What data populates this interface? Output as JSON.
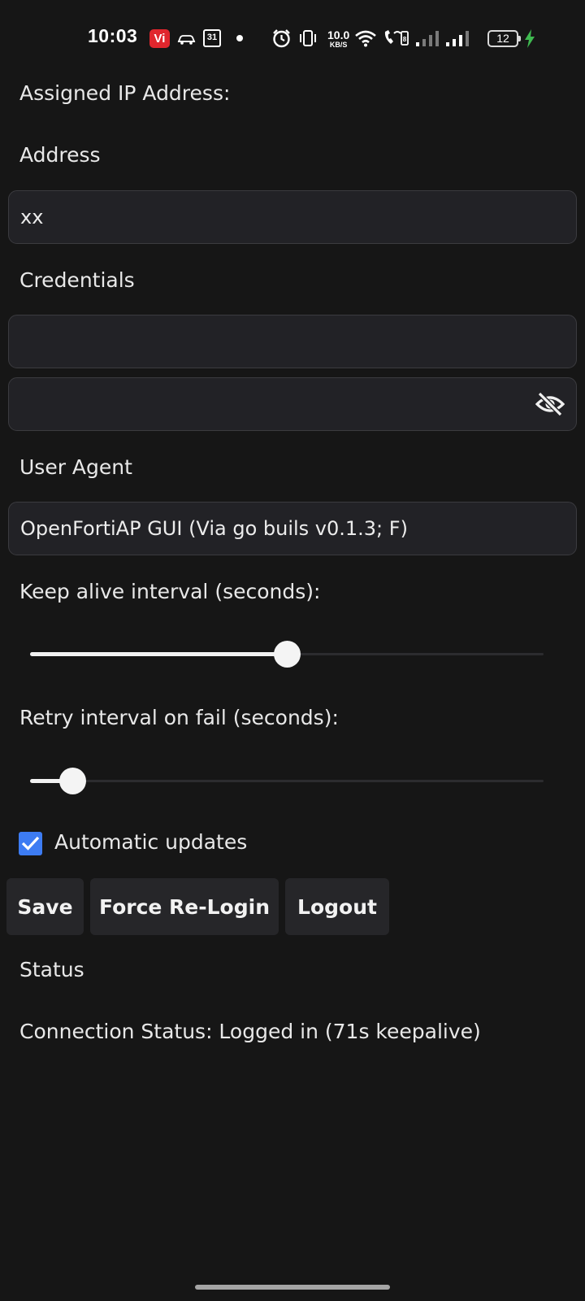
{
  "status_bar": {
    "time": "10:03",
    "carrier_badge": "Vi",
    "calendar_day": "31",
    "net_speed_value": "10.0",
    "net_speed_unit": "KB/S",
    "battery_level": "12",
    "icons": [
      "vi-app-icon",
      "car-icon",
      "calendar-icon",
      "dot-icon",
      "alarm-icon",
      "vibrate-icon",
      "wifi-icon",
      "volte-call-icon",
      "signal-sim1-icon",
      "signal-sim2-icon",
      "battery-icon",
      "charging-bolt-icon"
    ],
    "charging_color": "#3fb950"
  },
  "form": {
    "assigned_ip_label": "Assigned IP Address:",
    "address_label": "Address",
    "address_value": "xx",
    "credentials_label": "Credentials",
    "username_value": "",
    "password_value": "",
    "password_toggle_icon": "eye-off-icon",
    "user_agent_label": "User Agent",
    "user_agent_value": "OpenFortiAP GUI (Via go buils v0.1.3; F)",
    "keepalive_label": "Keep alive interval (seconds):",
    "keepalive_slider_fraction": 0.5,
    "retry_label": "Retry interval on fail (seconds):",
    "retry_slider_fraction": 0.083,
    "auto_updates_label": "Automatic updates",
    "auto_updates_checked": true,
    "accent_color": "#3d7cf3"
  },
  "buttons": {
    "save": "Save",
    "force_relogin": "Force Re-Login",
    "logout": "Logout"
  },
  "status": {
    "heading": "Status",
    "connection_status": "Connection Status: Logged in (71s keepalive)"
  }
}
